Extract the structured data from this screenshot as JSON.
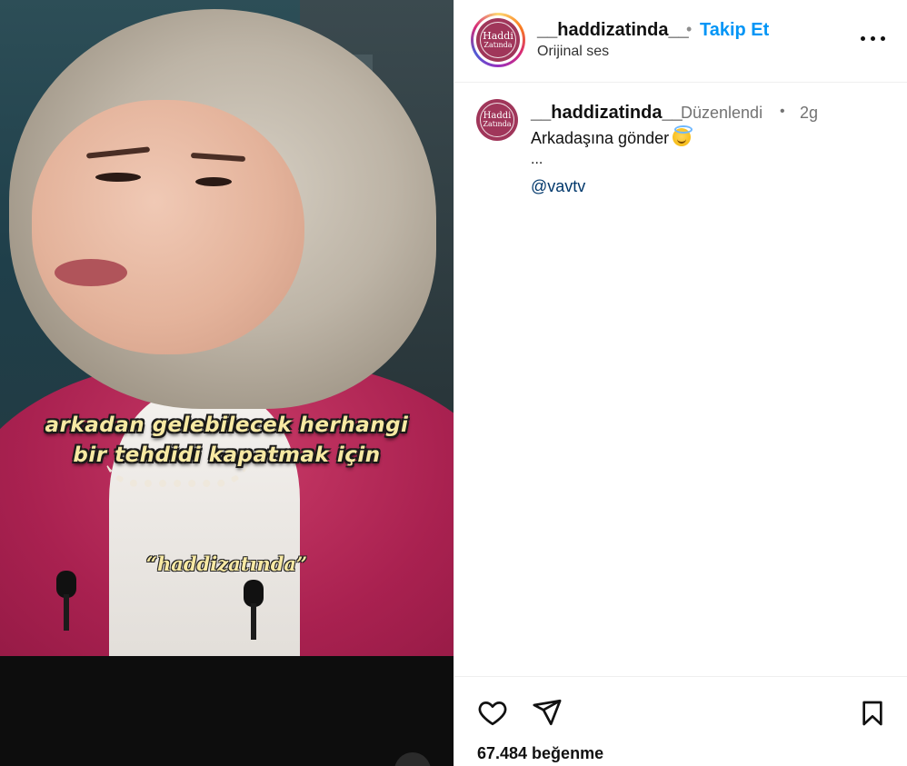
{
  "post": {
    "caption_line1": "arkadan gelebilecek herhangi",
    "caption_line2": "bir tehdidi kapatmak için",
    "watermark": "“haddizatında”"
  },
  "header": {
    "username": "__haddizatinda__",
    "separator": "•",
    "follow_label": "Takip Et",
    "audio_label": "Orijinal ses",
    "logo_word1": "Haddi",
    "logo_word2": "Zatında",
    "more_icon": "more-horizontal-icon"
  },
  "comment": {
    "username": "__haddizatinda__",
    "edited_label": "Düzenlendi",
    "separator": "•",
    "age": "2g",
    "text": "Arkadaşına gönder",
    "emoji": "smiling-face-with-halo",
    "ellipsis": "...",
    "mention": "@vavtv",
    "logo_word1": "Haddi",
    "logo_word2": "Zatında"
  },
  "actions": {
    "like_icon": "heart-icon",
    "share_icon": "paper-plane-icon",
    "save_icon": "bookmark-icon",
    "likes_text": "67.484 beğenme"
  },
  "colors": {
    "follow_blue": "#0095f6",
    "mention_blue": "#00376b",
    "logo_bg": "#a0365a",
    "caption_yellow": "#f7e9a3"
  }
}
